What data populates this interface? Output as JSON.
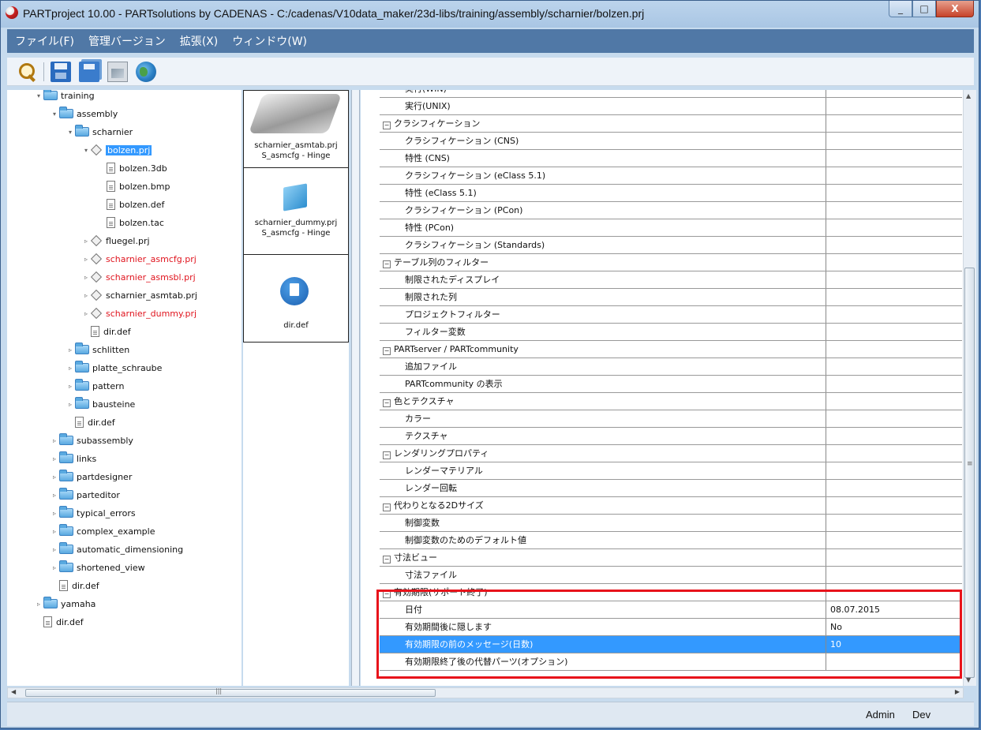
{
  "window": {
    "title": "PARTproject 10.00 - PARTsolutions by CADENAS - C:/cadenas/V10data_maker/23d-libs/training/assembly/scharnier/bolzen.prj",
    "minimize": "_",
    "maximize": "□",
    "close": "X"
  },
  "menu": [
    "ファイル(F)",
    "管理バージョン",
    "拡張(X)",
    "ウィンドウ(W)"
  ],
  "toolbar": {
    "icons": [
      "search-icon",
      "save-icon",
      "save-all-icon",
      "image-icon",
      "globe-icon"
    ]
  },
  "tree": [
    {
      "label": "training",
      "icon": "folder-open",
      "level": 0,
      "expander": "▾"
    },
    {
      "label": "assembly",
      "icon": "folder-open",
      "level": 1,
      "expander": "▾"
    },
    {
      "label": "scharnier",
      "icon": "folder-open",
      "level": 2,
      "expander": "▾"
    },
    {
      "label": "bolzen.prj",
      "icon": "project",
      "level": 3,
      "expander": "▾",
      "selected": true
    },
    {
      "label": "bolzen.3db",
      "icon": "file",
      "level": 4
    },
    {
      "label": "bolzen.bmp",
      "icon": "file",
      "level": 4
    },
    {
      "label": "bolzen.def",
      "icon": "file",
      "level": 4
    },
    {
      "label": "bolzen.tac",
      "icon": "file",
      "level": 4
    },
    {
      "label": "fluegel.prj",
      "icon": "project",
      "level": 3,
      "expander": "▹"
    },
    {
      "label": "scharnier_asmcfg.prj",
      "icon": "pencil",
      "level": 3,
      "expander": "▹",
      "red": true
    },
    {
      "label": "scharnier_asmsbl.prj",
      "icon": "triangle",
      "level": 3,
      "expander": "▹",
      "red": true
    },
    {
      "label": "scharnier_asmtab.prj",
      "icon": "project",
      "level": 3,
      "expander": "▹"
    },
    {
      "label": "scharnier_dummy.prj",
      "icon": "project",
      "level": 3,
      "expander": "▹",
      "red": true
    },
    {
      "label": "dir.def",
      "icon": "file",
      "level": 3
    },
    {
      "label": "schlitten",
      "icon": "folder",
      "level": 2,
      "expander": "▹"
    },
    {
      "label": "platte_schraube",
      "icon": "folder",
      "level": 2,
      "expander": "▹"
    },
    {
      "label": "pattern",
      "icon": "folder",
      "level": 2,
      "expander": "▹"
    },
    {
      "label": "bausteine",
      "icon": "folder",
      "level": 2,
      "expander": "▹"
    },
    {
      "label": "dir.def",
      "icon": "file",
      "level": 2
    },
    {
      "label": "subassembly",
      "icon": "folder",
      "level": 1,
      "expander": "▹"
    },
    {
      "label": "links",
      "icon": "folder",
      "level": 1,
      "expander": "▹"
    },
    {
      "label": "partdesigner",
      "icon": "folder",
      "level": 1,
      "expander": "▹"
    },
    {
      "label": "parteditor",
      "icon": "folder",
      "level": 1,
      "expander": "▹"
    },
    {
      "label": "typical_errors",
      "icon": "folder",
      "level": 1,
      "expander": "▹"
    },
    {
      "label": "complex_example",
      "icon": "folder",
      "level": 1,
      "expander": "▹"
    },
    {
      "label": "automatic_dimensioning",
      "icon": "folder",
      "level": 1,
      "expander": "▹"
    },
    {
      "label": "shortened_view",
      "icon": "folder",
      "level": 1,
      "expander": "▹"
    },
    {
      "label": "dir.def",
      "icon": "file",
      "level": 1
    },
    {
      "label": "yamaha",
      "icon": "folder",
      "level": 0,
      "expander": "▹"
    },
    {
      "label": "dir.def",
      "icon": "file",
      "level": 0
    }
  ],
  "previews": [
    {
      "line1": "scharnier_asmtab.prj",
      "line2": "S_asmcfg - Hinge",
      "thumb": "hinge"
    },
    {
      "line1": "scharnier_dummy.prj",
      "line2": "S_asmcfg - Hinge",
      "thumb": "cube"
    },
    {
      "line1": "dir.def",
      "line2": "",
      "thumb": "document"
    }
  ],
  "properties": [
    {
      "key": "実行(WIN)",
      "value": "",
      "group": false
    },
    {
      "key": "実行(UNIX)",
      "value": "",
      "group": false
    },
    {
      "key": "クラシフィケーション",
      "value": "",
      "group": true
    },
    {
      "key": "クラシフィケーション (CNS)",
      "value": "",
      "group": false
    },
    {
      "key": "特性 (CNS)",
      "value": "",
      "group": false
    },
    {
      "key": "クラシフィケーション (eClass 5.1)",
      "value": "",
      "group": false
    },
    {
      "key": "特性 (eClass 5.1)",
      "value": "",
      "group": false
    },
    {
      "key": "クラシフィケーション (PCon)",
      "value": "",
      "group": false
    },
    {
      "key": "特性 (PCon)",
      "value": "",
      "group": false
    },
    {
      "key": "クラシフィケーション (Standards)",
      "value": "",
      "group": false
    },
    {
      "key": "テーブル列のフィルター",
      "value": "",
      "group": true
    },
    {
      "key": "制限されたディスプレイ",
      "value": "",
      "group": false
    },
    {
      "key": "制限された列",
      "value": "",
      "group": false
    },
    {
      "key": "プロジェクトフィルター",
      "value": "",
      "group": false
    },
    {
      "key": "フィルター変数",
      "value": "",
      "group": false
    },
    {
      "key": "PARTserver / PARTcommunity",
      "value": "",
      "group": true
    },
    {
      "key": "追加ファイル",
      "value": "",
      "group": false
    },
    {
      "key": "PARTcommunity の表示",
      "value": "",
      "group": false
    },
    {
      "key": "色とテクスチャ",
      "value": "",
      "group": true
    },
    {
      "key": "カラー",
      "value": "",
      "group": false
    },
    {
      "key": "テクスチャ",
      "value": "",
      "group": false
    },
    {
      "key": "レンダリングプロパティ",
      "value": "",
      "group": true
    },
    {
      "key": "レンダーマテリアル",
      "value": "",
      "group": false
    },
    {
      "key": "レンダー回転",
      "value": "",
      "group": false
    },
    {
      "key": "代わりとなる2Dサイズ",
      "value": "",
      "group": true
    },
    {
      "key": "制御変数",
      "value": "",
      "group": false
    },
    {
      "key": "制御変数のためのデフォルト値",
      "value": "",
      "group": false
    },
    {
      "key": "寸法ビュー",
      "value": "",
      "group": true
    },
    {
      "key": "寸法ファイル",
      "value": "",
      "group": false
    },
    {
      "key": "有効期限(サポート終了)",
      "value": "",
      "group": true
    },
    {
      "key": "日付",
      "value": "08.07.2015",
      "group": false
    },
    {
      "key": "有効期間後に隠します",
      "value": "No",
      "group": false
    },
    {
      "key": "有効期限の前のメッセージ(日数)",
      "value": "10",
      "group": false,
      "selected": true
    },
    {
      "key": "有効期限終了後の代替パーツ(オプション)",
      "value": "",
      "group": false
    }
  ],
  "status": {
    "user": "Admin",
    "mode": "Dev"
  },
  "colors": {
    "selection": "#3399ff",
    "highlight_box": "#e8131b",
    "red_text": "#e0141e",
    "menubar": "#5078a6"
  }
}
